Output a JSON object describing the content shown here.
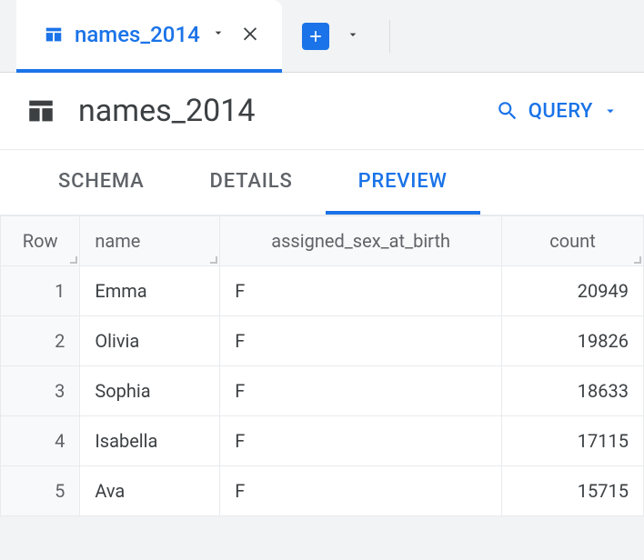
{
  "top_tab": {
    "label": "names_2014"
  },
  "header": {
    "title": "names_2014",
    "query_label": "QUERY"
  },
  "section_tabs": {
    "schema": "SCHEMA",
    "details": "DETAILS",
    "preview": "PREVIEW"
  },
  "columns": {
    "row": "Row",
    "name": "name",
    "sex": "assigned_sex_at_birth",
    "count": "count"
  },
  "rows": [
    {
      "n": "1",
      "name": "Emma",
      "sex": "F",
      "count": "20949"
    },
    {
      "n": "2",
      "name": "Olivia",
      "sex": "F",
      "count": "19826"
    },
    {
      "n": "3",
      "name": "Sophia",
      "sex": "F",
      "count": "18633"
    },
    {
      "n": "4",
      "name": "Isabella",
      "sex": "F",
      "count": "17115"
    },
    {
      "n": "5",
      "name": "Ava",
      "sex": "F",
      "count": "15715"
    }
  ]
}
